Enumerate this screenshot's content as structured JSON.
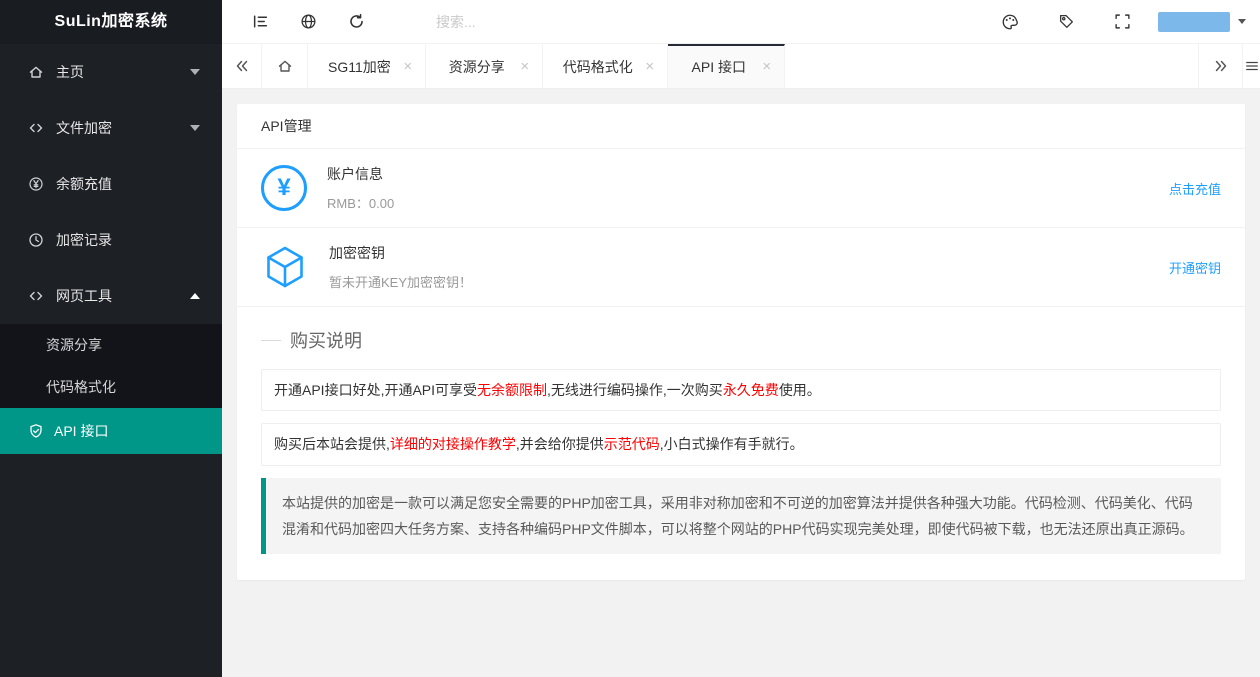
{
  "app_title": "SuLin加密系统",
  "glyphs": {
    "close": "×",
    "yen": "¥"
  },
  "topbar": {
    "search_placeholder": "搜索..."
  },
  "sidebar": {
    "items": [
      {
        "label": "主页"
      },
      {
        "label": "文件加密"
      },
      {
        "label": "余额充值"
      },
      {
        "label": "加密记录"
      },
      {
        "label": "网页工具"
      }
    ],
    "sub_items": [
      {
        "label": "资源分享"
      },
      {
        "label": "代码格式化"
      },
      {
        "label": "API 接口"
      }
    ]
  },
  "tabs": {
    "items": [
      {
        "label": "SG11加密"
      },
      {
        "label": "资源分享"
      },
      {
        "label": "代码格式化"
      },
      {
        "label": "API 接口"
      }
    ]
  },
  "page": {
    "title": "API管理",
    "account": {
      "title": "账户信息",
      "balance": "RMB：0.00",
      "action": "点击充值"
    },
    "secret": {
      "title": "加密密钥",
      "status": "暂未开通KEY加密密钥！",
      "action": "开通密钥"
    },
    "purchase": {
      "heading": "购买说明",
      "para1": [
        {
          "text": "开通API接口好处,开通API可享受"
        },
        {
          "text": "无余额限制",
          "color": "#ff0000"
        },
        {
          "text": ",无线进行编码操作,一次购买"
        },
        {
          "text": "永久免费",
          "color": "#ff0000"
        },
        {
          "text": "使用。"
        }
      ],
      "para2": [
        {
          "text": "购买后本站会提供,"
        },
        {
          "text": "详细的对接操作教学",
          "color": "#ff0000"
        },
        {
          "text": ",并会给你提供"
        },
        {
          "text": "示范代码",
          "color": "#ff0000"
        },
        {
          "text": ",小白式操作有手就行。"
        }
      ]
    },
    "notice": "本站提供的加密是一款可以满足您安全需要的PHP加密工具，采用非对称加密和不可逆的加密算法并提供各种强大功能。代码检测、代码美化、代码混淆和代码加密四大任务方案、支持各种编码PHP文件脚本，可以将整个网站的PHP代码实现完美处理，即使代码被下载，也无法还原出真正源码。"
  }
}
